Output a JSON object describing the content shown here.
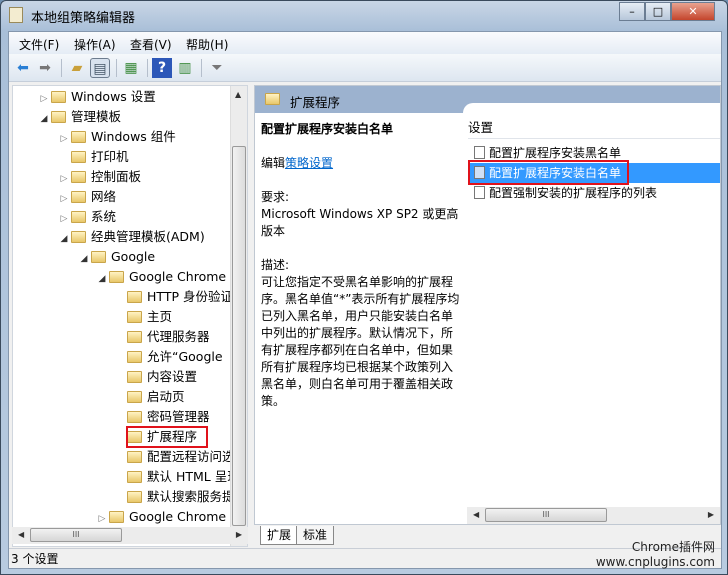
{
  "window": {
    "title": "本地组策略编辑器",
    "controls": [
      "–",
      "□",
      "✕"
    ]
  },
  "menu": [
    "文件(F)",
    "操作(A)",
    "查看(V)",
    "帮助(H)"
  ],
  "toolbar": {
    "icons": [
      "back-arrow-icon",
      "forward-arrow-icon",
      "up-folder-icon",
      "show-hide-tree-icon",
      "export-list-icon",
      "help-icon",
      "show-action-pane-icon",
      "filter-icon"
    ]
  },
  "tree": [
    {
      "label": "Windows 设置",
      "level": 1,
      "toggle": "collapsed"
    },
    {
      "label": "管理模板",
      "level": 1,
      "toggle": "expanded"
    },
    {
      "label": "Windows 组件",
      "level": 2,
      "toggle": "collapsed"
    },
    {
      "label": "打印机",
      "level": 2,
      "toggle": "none"
    },
    {
      "label": "控制面板",
      "level": 2,
      "toggle": "collapsed"
    },
    {
      "label": "网络",
      "level": 2,
      "toggle": "collapsed"
    },
    {
      "label": "系统",
      "level": 2,
      "toggle": "collapsed"
    },
    {
      "label": "经典管理模板(ADM)",
      "level": 2,
      "toggle": "expanded"
    },
    {
      "label": "Google",
      "level": 3,
      "toggle": "expanded"
    },
    {
      "label": "Google Chrome",
      "level": 4,
      "toggle": "expanded"
    },
    {
      "label": "HTTP 身份验证",
      "level": 5,
      "toggle": "none"
    },
    {
      "label": "主页",
      "level": 5,
      "toggle": "none"
    },
    {
      "label": "代理服务器",
      "level": 5,
      "toggle": "none"
    },
    {
      "label": "允许“Google",
      "level": 5,
      "toggle": "none"
    },
    {
      "label": "内容设置",
      "level": 5,
      "toggle": "none"
    },
    {
      "label": "启动页",
      "level": 5,
      "toggle": "none"
    },
    {
      "label": "密码管理器",
      "level": 5,
      "toggle": "none"
    },
    {
      "label": "扩展程序",
      "level": 5,
      "toggle": "none",
      "highlighted": true
    },
    {
      "label": "配置远程访问选",
      "level": 5,
      "toggle": "none"
    },
    {
      "label": "默认 HTML 呈现",
      "level": 5,
      "toggle": "none"
    },
    {
      "label": "默认搜索服务提",
      "level": 5,
      "toggle": "none"
    },
    {
      "label": "Google Chrome (",
      "level": 4,
      "toggle": "collapsed"
    }
  ],
  "right": {
    "header": "扩展程序",
    "policy_title": "配置扩展程序安装白名单",
    "edit_prefix": "编辑",
    "edit_link": "策略设置",
    "requirements_label": "要求:",
    "requirements": "Microsoft Windows XP SP2 或更高版本",
    "description_label": "描述:",
    "description": "可让您指定不受黑名单影响的扩展程序。黑名单值“*”表示所有扩展程序均已列入黑名单，用户只能安装白名单中列出的扩展程序。默认情况下，所有扩展程序都列在白名单中，但如果所有扩展程序均已根据某个政策列入黑名单，则白名单可用于覆盖相关政策。",
    "list_header": "设置",
    "items": [
      {
        "label": "配置扩展程序安装黑名单",
        "selected": false
      },
      {
        "label": "配置扩展程序安装白名单",
        "selected": true
      },
      {
        "label": "配置强制安装的扩展程序的列表",
        "selected": false
      }
    ]
  },
  "tabs": [
    {
      "label": "扩展",
      "active": true
    },
    {
      "label": "标准",
      "active": false
    }
  ],
  "status": "3 个设置",
  "watermark": {
    "line1": "Chrome插件网",
    "line2": "www.cnplugins.com"
  },
  "colors": {
    "selection": "#3399ff",
    "highlight_box": "#e0121b",
    "header_band": "#9cb2cf",
    "link": "#0066cc"
  }
}
